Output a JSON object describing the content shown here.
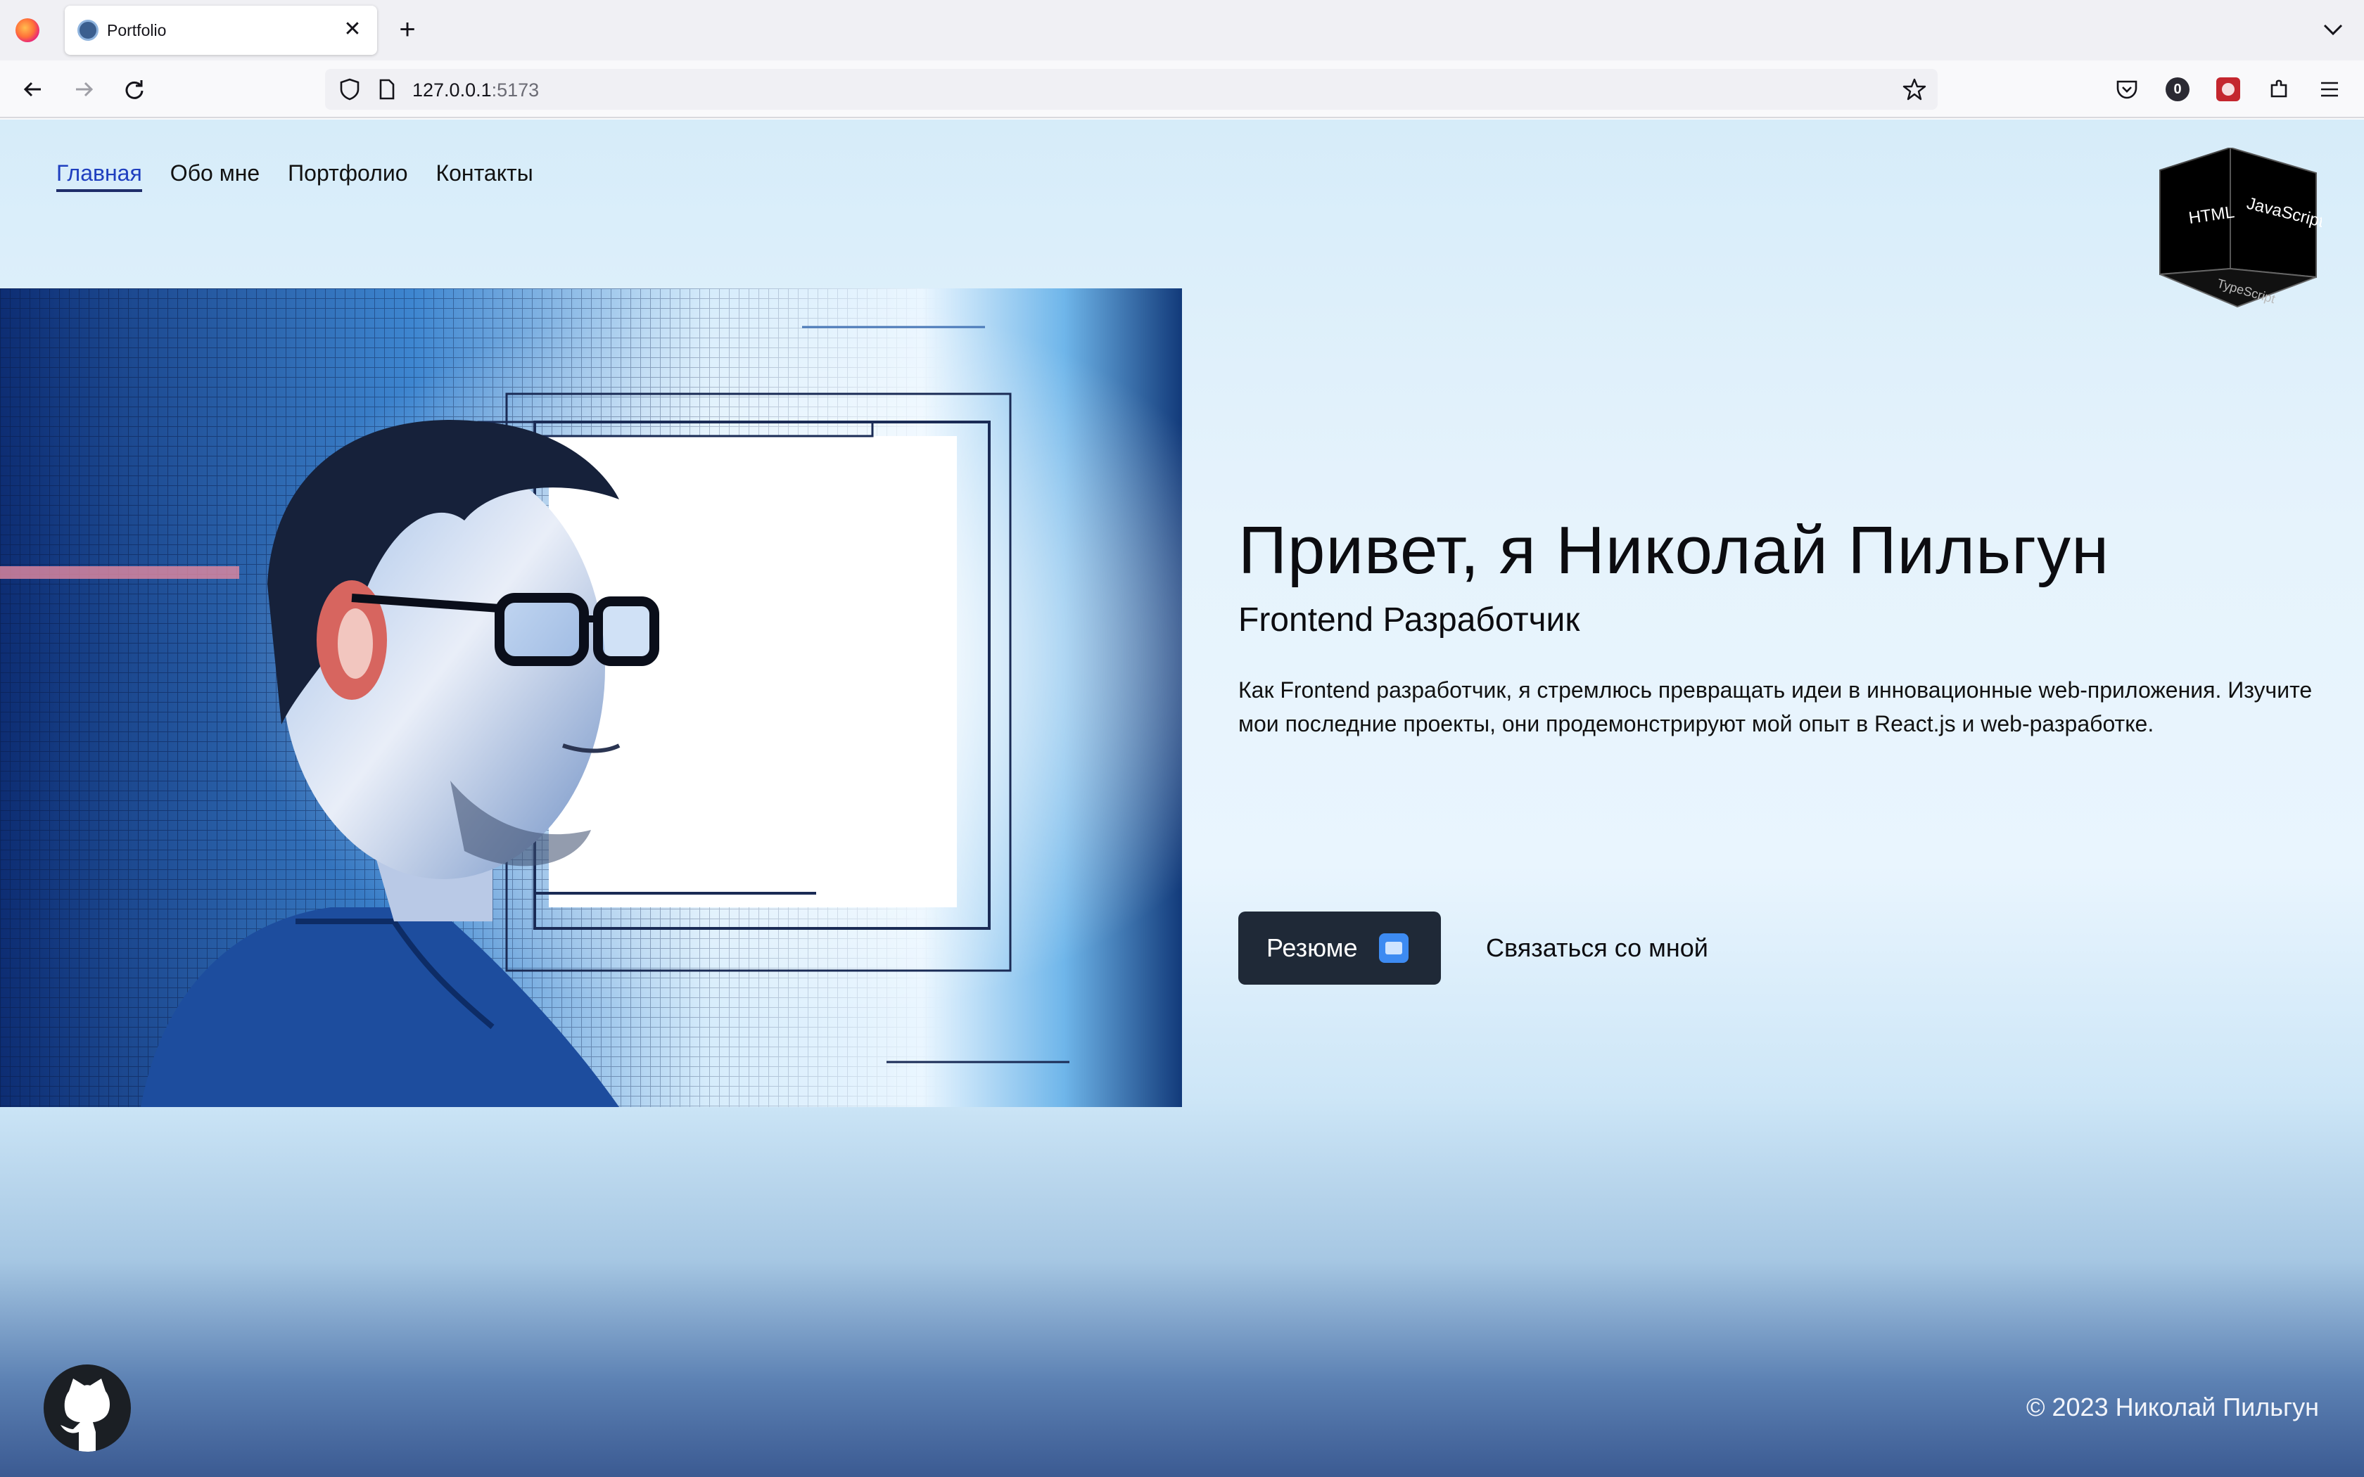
{
  "browser": {
    "tab_title": "Portfolio",
    "tab_close": "✕",
    "new_tab": "+",
    "url_host": "127.0.0.1",
    "url_port": ":5173",
    "icons": [
      "firefox-logo",
      "back-arrow",
      "forward-arrow",
      "reload",
      "shield",
      "page",
      "bookmark-star",
      "pocket",
      "extension-badge",
      "extension-red",
      "extensions-puzzle",
      "menu"
    ],
    "badge_count": "0"
  },
  "site": {
    "nav": [
      {
        "label": "Главная",
        "active": true
      },
      {
        "label": "Обо мне",
        "active": false
      },
      {
        "label": "Портфолио",
        "active": false
      },
      {
        "label": "Контакты",
        "active": false
      }
    ],
    "cube": {
      "front": "HTML",
      "right": "JavaScript",
      "bottom": "TypeScript"
    },
    "hero": {
      "title": "Привет, я Николай Пильгун",
      "subtitle": "Frontend Разработчик",
      "description": "Как Frontend разработчик, я стремлюсь превращать идеи в инновационные web-приложения. Изучите мои последние проекты, они продемонстрируют мой опыт в React.js и web-разработке.",
      "resume_button": "Резюме",
      "contact_button": "Связаться со мной"
    },
    "footer": {
      "copyright": "© 2023 Николай Пильгун"
    }
  },
  "colors": {
    "accent_nav": "#1f3fbf",
    "button_bg": "#1f2937",
    "footer_gradient_end": "#3b5a92"
  }
}
